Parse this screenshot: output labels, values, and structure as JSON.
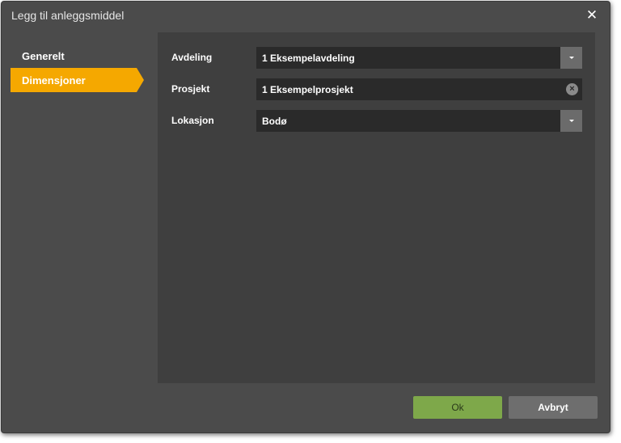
{
  "dialog": {
    "title": "Legg til anleggsmiddel",
    "close_symbol": "✕"
  },
  "nav": {
    "items": [
      {
        "label": "Generelt",
        "active": false
      },
      {
        "label": "Dimensjoner",
        "active": true
      }
    ],
    "active_color": "#f5a800"
  },
  "form": {
    "avdeling": {
      "label": "Avdeling",
      "value": "1 Eksempelavdeling"
    },
    "prosjekt": {
      "label": "Prosjekt",
      "value": "1 Eksempelprosjekt",
      "clear_symbol": "×"
    },
    "lokasjon": {
      "label": "Lokasjon",
      "value": "Bodø"
    }
  },
  "footer": {
    "ok_label": "Ok",
    "cancel_label": "Avbryt",
    "ok_color": "#7ea84a"
  },
  "icons": {
    "close": "close-icon",
    "dropdown": "chevron-down-icon",
    "clear": "clear-icon"
  }
}
